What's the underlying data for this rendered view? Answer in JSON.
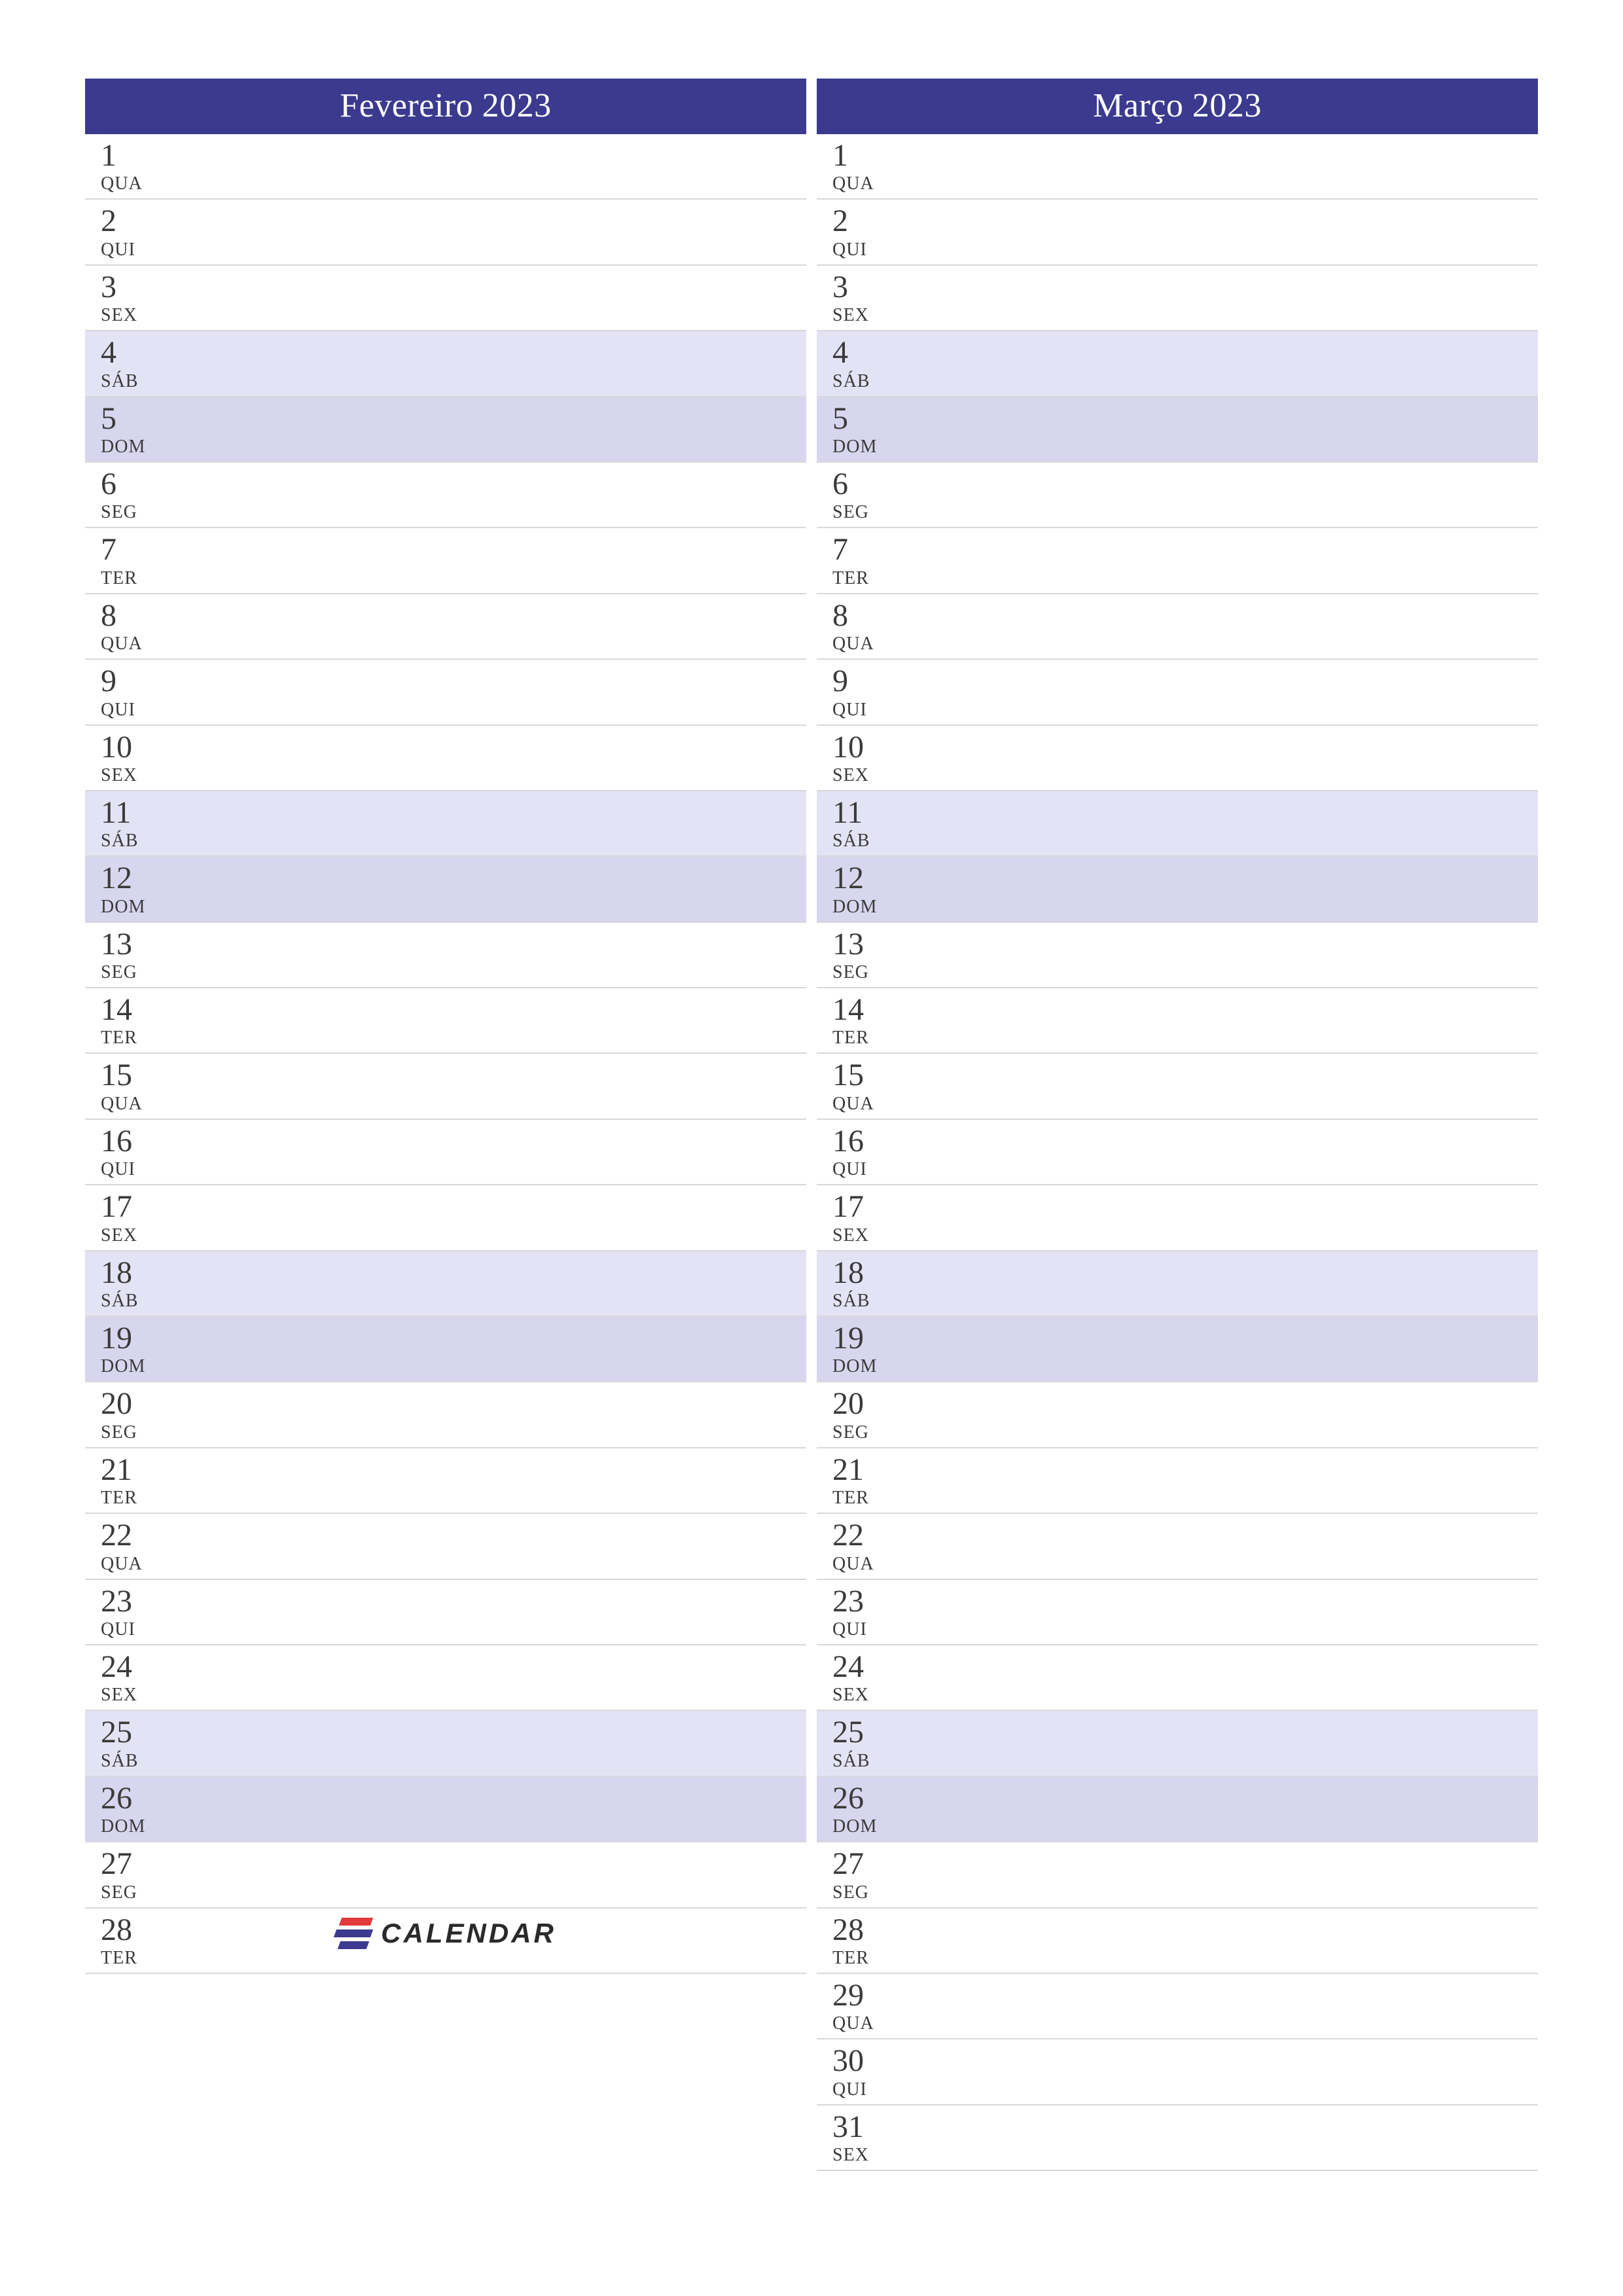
{
  "logo_text": "CALENDAR",
  "months": [
    {
      "title": "Fevereiro 2023",
      "days": [
        {
          "num": "1",
          "abbr": "QUA",
          "kind": "weekday"
        },
        {
          "num": "2",
          "abbr": "QUI",
          "kind": "weekday"
        },
        {
          "num": "3",
          "abbr": "SEX",
          "kind": "weekday"
        },
        {
          "num": "4",
          "abbr": "SÁB",
          "kind": "sat"
        },
        {
          "num": "5",
          "abbr": "DOM",
          "kind": "sun"
        },
        {
          "num": "6",
          "abbr": "SEG",
          "kind": "weekday"
        },
        {
          "num": "7",
          "abbr": "TER",
          "kind": "weekday"
        },
        {
          "num": "8",
          "abbr": "QUA",
          "kind": "weekday"
        },
        {
          "num": "9",
          "abbr": "QUI",
          "kind": "weekday"
        },
        {
          "num": "10",
          "abbr": "SEX",
          "kind": "weekday"
        },
        {
          "num": "11",
          "abbr": "SÁB",
          "kind": "sat"
        },
        {
          "num": "12",
          "abbr": "DOM",
          "kind": "sun"
        },
        {
          "num": "13",
          "abbr": "SEG",
          "kind": "weekday"
        },
        {
          "num": "14",
          "abbr": "TER",
          "kind": "weekday"
        },
        {
          "num": "15",
          "abbr": "QUA",
          "kind": "weekday"
        },
        {
          "num": "16",
          "abbr": "QUI",
          "kind": "weekday"
        },
        {
          "num": "17",
          "abbr": "SEX",
          "kind": "weekday"
        },
        {
          "num": "18",
          "abbr": "SÁB",
          "kind": "sat"
        },
        {
          "num": "19",
          "abbr": "DOM",
          "kind": "sun"
        },
        {
          "num": "20",
          "abbr": "SEG",
          "kind": "weekday"
        },
        {
          "num": "21",
          "abbr": "TER",
          "kind": "weekday"
        },
        {
          "num": "22",
          "abbr": "QUA",
          "kind": "weekday"
        },
        {
          "num": "23",
          "abbr": "QUI",
          "kind": "weekday"
        },
        {
          "num": "24",
          "abbr": "SEX",
          "kind": "weekday"
        },
        {
          "num": "25",
          "abbr": "SÁB",
          "kind": "sat"
        },
        {
          "num": "26",
          "abbr": "DOM",
          "kind": "sun"
        },
        {
          "num": "27",
          "abbr": "SEG",
          "kind": "weekday"
        },
        {
          "num": "28",
          "abbr": "TER",
          "kind": "weekday"
        }
      ]
    },
    {
      "title": "Março 2023",
      "days": [
        {
          "num": "1",
          "abbr": "QUA",
          "kind": "weekday"
        },
        {
          "num": "2",
          "abbr": "QUI",
          "kind": "weekday"
        },
        {
          "num": "3",
          "abbr": "SEX",
          "kind": "weekday"
        },
        {
          "num": "4",
          "abbr": "SÁB",
          "kind": "sat"
        },
        {
          "num": "5",
          "abbr": "DOM",
          "kind": "sun"
        },
        {
          "num": "6",
          "abbr": "SEG",
          "kind": "weekday"
        },
        {
          "num": "7",
          "abbr": "TER",
          "kind": "weekday"
        },
        {
          "num": "8",
          "abbr": "QUA",
          "kind": "weekday"
        },
        {
          "num": "9",
          "abbr": "QUI",
          "kind": "weekday"
        },
        {
          "num": "10",
          "abbr": "SEX",
          "kind": "weekday"
        },
        {
          "num": "11",
          "abbr": "SÁB",
          "kind": "sat"
        },
        {
          "num": "12",
          "abbr": "DOM",
          "kind": "sun"
        },
        {
          "num": "13",
          "abbr": "SEG",
          "kind": "weekday"
        },
        {
          "num": "14",
          "abbr": "TER",
          "kind": "weekday"
        },
        {
          "num": "15",
          "abbr": "QUA",
          "kind": "weekday"
        },
        {
          "num": "16",
          "abbr": "QUI",
          "kind": "weekday"
        },
        {
          "num": "17",
          "abbr": "SEX",
          "kind": "weekday"
        },
        {
          "num": "18",
          "abbr": "SÁB",
          "kind": "sat"
        },
        {
          "num": "19",
          "abbr": "DOM",
          "kind": "sun"
        },
        {
          "num": "20",
          "abbr": "SEG",
          "kind": "weekday"
        },
        {
          "num": "21",
          "abbr": "TER",
          "kind": "weekday"
        },
        {
          "num": "22",
          "abbr": "QUA",
          "kind": "weekday"
        },
        {
          "num": "23",
          "abbr": "QUI",
          "kind": "weekday"
        },
        {
          "num": "24",
          "abbr": "SEX",
          "kind": "weekday"
        },
        {
          "num": "25",
          "abbr": "SÁB",
          "kind": "sat"
        },
        {
          "num": "26",
          "abbr": "DOM",
          "kind": "sun"
        },
        {
          "num": "27",
          "abbr": "SEG",
          "kind": "weekday"
        },
        {
          "num": "28",
          "abbr": "TER",
          "kind": "weekday"
        },
        {
          "num": "29",
          "abbr": "QUA",
          "kind": "weekday"
        },
        {
          "num": "30",
          "abbr": "QUI",
          "kind": "weekday"
        },
        {
          "num": "31",
          "abbr": "SEX",
          "kind": "weekday"
        }
      ]
    }
  ]
}
